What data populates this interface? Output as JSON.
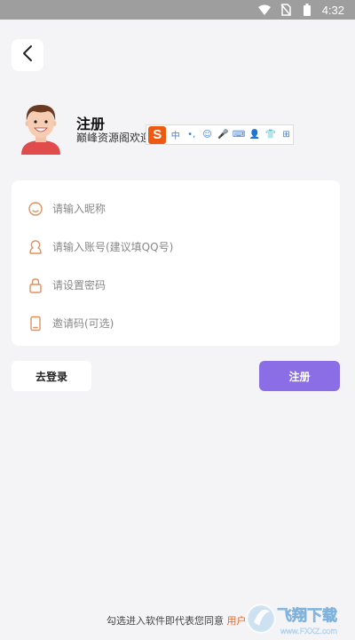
{
  "status_bar": {
    "time": "4:32",
    "icons": [
      "wifi-icon",
      "no-sim-icon",
      "battery-icon"
    ]
  },
  "header": {
    "back_icon": "chevron-left-icon",
    "title": "注册",
    "subtitle": "巅峰资源阁欢迎"
  },
  "ime_toolbar": {
    "logo": "S",
    "items": [
      "中",
      "•,",
      "☺",
      "🎤",
      "⌨",
      "👤",
      "👕",
      "⊞"
    ]
  },
  "form": {
    "nickname": {
      "placeholder": "请输入昵称",
      "value": "",
      "icon": "smiley-icon"
    },
    "account": {
      "placeholder": "请输入账号(建议填QQ号)",
      "value": "",
      "icon": "user-icon"
    },
    "password": {
      "placeholder": "请设置密码",
      "value": "",
      "icon": "lock-icon"
    },
    "invite": {
      "placeholder": "邀请码(可选)",
      "value": "",
      "icon": "phone-icon"
    }
  },
  "actions": {
    "login_label": "去登录",
    "register_label": "注册"
  },
  "footer": {
    "agreement_text": "勾选进入软件即代表您同意",
    "agreement_link": "用户"
  },
  "watermark": {
    "text": "飞翔下载",
    "url_text": "www.FXXZ.com"
  },
  "colors": {
    "accent": "#8b6ee6",
    "icon_orange": "#e0915e",
    "background": "#f4f4f6"
  }
}
